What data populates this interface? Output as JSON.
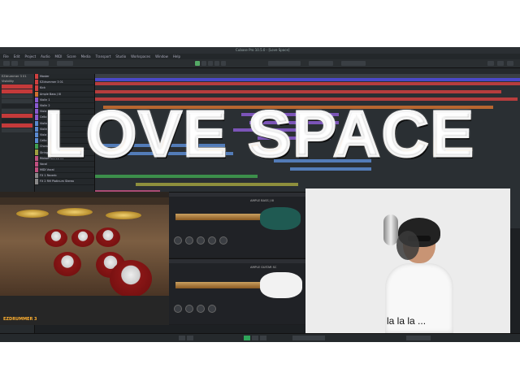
{
  "window": {
    "title": "Cubase Pro 10.5.0 - [Love Space]"
  },
  "menu": [
    "File",
    "Edit",
    "Project",
    "Audio",
    "MIDI",
    "Score",
    "Media",
    "Transport",
    "Studio",
    "Workspaces",
    "Window",
    "Help"
  ],
  "title_overlay": "LOVE SPACE",
  "inspector": {
    "track_name": "EZdrummer 3 01",
    "label": "Visibility"
  },
  "tracks": [
    {
      "name": "Master",
      "color": "#d04040"
    },
    {
      "name": "EZdrummer 3 01",
      "color": "#d04040"
    },
    {
      "name": "Kick",
      "color": "#d04040"
    },
    {
      "name": "Ample Bass J III",
      "color": "#d07030"
    },
    {
      "name": "Violin 1",
      "color": "#8a5ad0"
    },
    {
      "name": "Violin 2",
      "color": "#8a5ad0"
    },
    {
      "name": "Viola",
      "color": "#8a5ad0"
    },
    {
      "name": "Cello",
      "color": "#8a5ad0"
    },
    {
      "name": "Violin 1",
      "color": "#5a8ad0"
    },
    {
      "name": "Violin 2",
      "color": "#5a8ad0"
    },
    {
      "name": "Viola",
      "color": "#5a8ad0"
    },
    {
      "name": "Cello",
      "color": "#5a8ad0"
    },
    {
      "name": "Chorus",
      "color": "#40a050"
    },
    {
      "name": "Strings",
      "color": "#a0a040"
    },
    {
      "name": "Ribbon Stereo 01",
      "color": "#c05080"
    },
    {
      "name": "Vocal",
      "color": "#c05080"
    },
    {
      "name": "MIDI Vocal",
      "color": "#c05080"
    },
    {
      "name": "FX 1 Reverb",
      "color": "#888888"
    },
    {
      "name": "FX 2 RM Platinum Stereo",
      "color": "#888888"
    }
  ],
  "panels": {
    "drums_title": "EZDRUMMER 3",
    "bass_preset": "AMPLE BASS J III",
    "guitar_preset": "AMPLE GUITAR SC"
  },
  "video": {
    "lyric": "la la la ..."
  },
  "colors": {
    "cycle": "#4a48c8",
    "accent": "#2fa55a"
  }
}
